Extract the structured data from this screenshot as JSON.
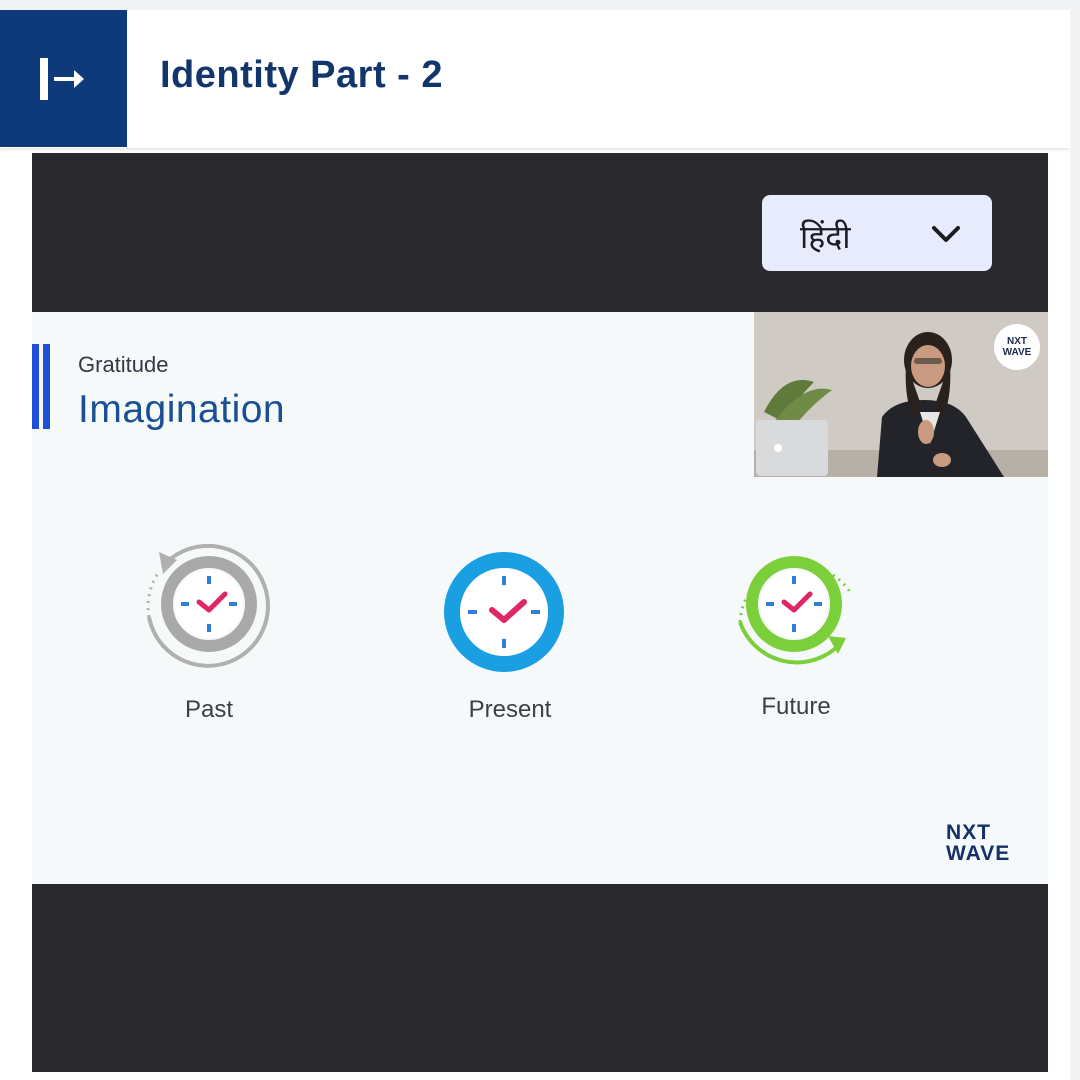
{
  "header": {
    "title": "Identity Part - 2",
    "exit_icon": "exit-arrow-icon"
  },
  "player": {
    "language": {
      "selected": "हिंदी",
      "icon": "chevron-down-icon"
    },
    "slide": {
      "subtitle": "Gratitude",
      "heading": "Imagination",
      "icons": [
        {
          "label": "Past",
          "icon": "past-clock-icon",
          "color": "#a9a9a9"
        },
        {
          "label": "Present",
          "icon": "present-clock-icon",
          "color": "#1a9fe3"
        },
        {
          "label": "Future",
          "icon": "future-clock-icon",
          "color": "#7bcf3b"
        }
      ],
      "webcam_logo": {
        "line1": "NXT",
        "line2": "WAVE"
      },
      "logo": {
        "line1": "NXT",
        "line2": "WAVE"
      }
    }
  },
  "colors": {
    "header_blue": "#0e3a7a",
    "title_text": "#12366c",
    "player_bg": "#2a2a2e",
    "accent_blue": "#1e4fd6"
  }
}
